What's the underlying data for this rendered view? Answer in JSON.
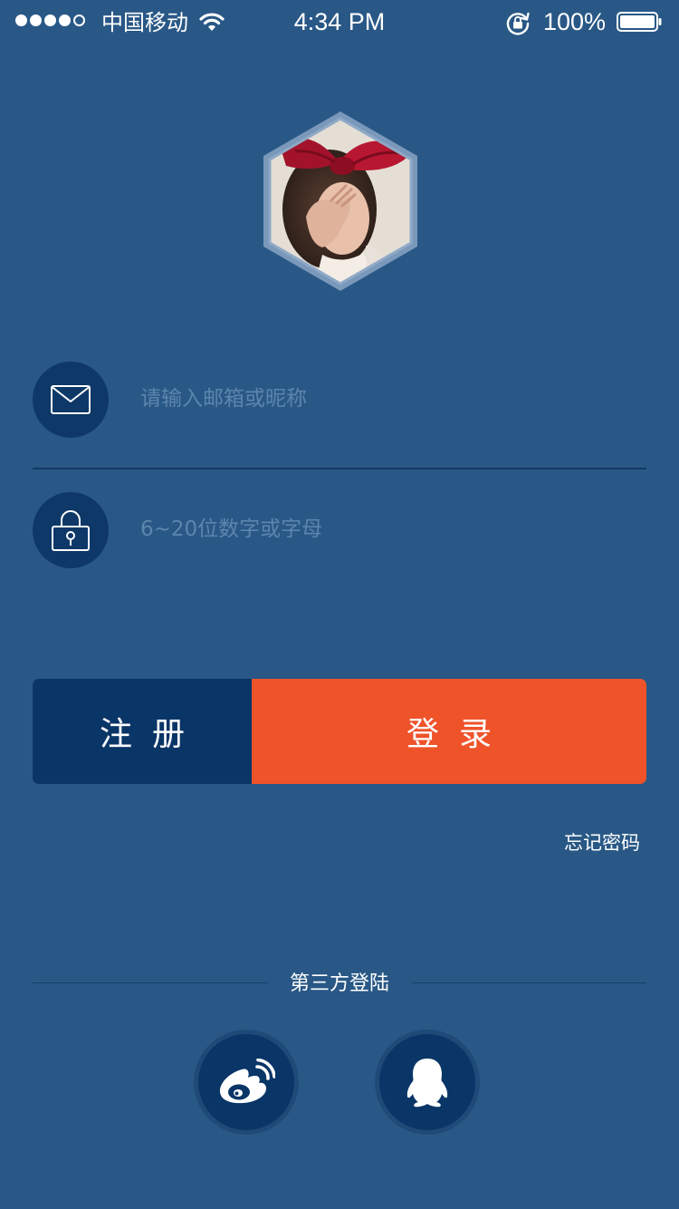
{
  "status_bar": {
    "carrier": "中国移动",
    "time": "4:34 PM",
    "battery": "100%",
    "signal_bars_filled": 4,
    "signal_bars_total": 5,
    "icons": [
      "signal-dots-icon",
      "wifi-icon",
      "rotation-lock-icon",
      "battery-icon"
    ]
  },
  "avatar": {
    "icon": "user-avatar-hexagon"
  },
  "form": {
    "email": {
      "icon": "mail-icon",
      "placeholder": "请输入邮箱或昵称",
      "value": ""
    },
    "password": {
      "icon": "lock-icon",
      "placeholder": "6~20位数字或字母",
      "value": ""
    }
  },
  "buttons": {
    "register": "注册",
    "login": "登录"
  },
  "forgot_password": "忘记密码",
  "third_party": {
    "title": "第三方登陆",
    "providers": [
      {
        "icon": "weibo-icon"
      },
      {
        "icon": "qq-icon"
      }
    ]
  },
  "colors": {
    "background": "#295886",
    "dark_navy": "#0a3567",
    "accent_orange": "#ef532a",
    "placeholder": "#5c85ad",
    "text": "#ffffff"
  }
}
